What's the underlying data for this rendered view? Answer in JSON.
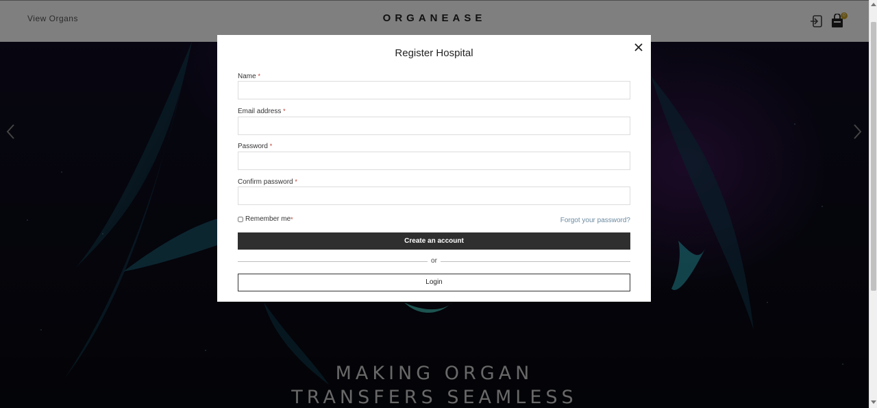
{
  "header": {
    "nav_link": "View Organs",
    "brand": "ORGANEASE",
    "cart_count": "0"
  },
  "hero": {
    "title_line1": "MAKING ORGAN",
    "title_line2": "TRANSFERS SEAMLESS"
  },
  "modal": {
    "title": "Register Hospital",
    "fields": [
      {
        "label": "Name",
        "required_mark": "*",
        "value": ""
      },
      {
        "label": "Email address",
        "required_mark": "*",
        "value": ""
      },
      {
        "label": "Password",
        "required_mark": "*",
        "value": ""
      },
      {
        "label": "Confirm password",
        "required_mark": "*",
        "value": ""
      }
    ],
    "remember_label": "Remember me",
    "remember_required_mark": "*",
    "remember_checked": false,
    "forgot_link": "Forgot your password?",
    "create_button": "Create an account",
    "divider_text": "or",
    "login_button": "Login"
  },
  "colors": {
    "primary_button": "#2f2f2f",
    "link": "#6b8aa0",
    "badge": "#c9a227",
    "required": "#c0392b"
  }
}
